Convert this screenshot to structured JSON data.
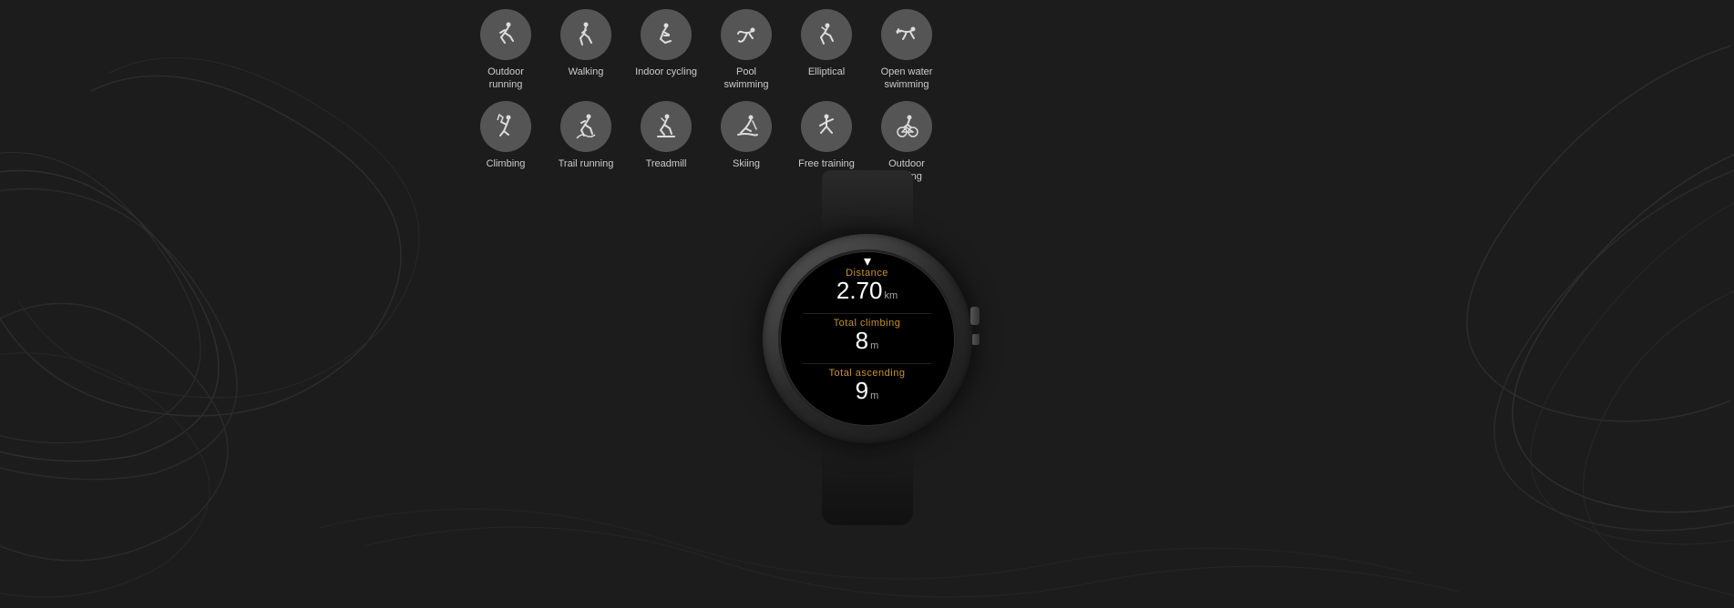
{
  "background": {
    "color": "#1a1a1a"
  },
  "activities": {
    "row1": [
      {
        "id": "outdoor-running",
        "label": "Outdoor running",
        "icon": "runner"
      },
      {
        "id": "walking",
        "label": "Walking",
        "icon": "walking"
      },
      {
        "id": "indoor-cycling",
        "label": "Indoor cycling",
        "icon": "cycling"
      },
      {
        "id": "pool-swimming",
        "label": "Pool swimming",
        "icon": "swimming"
      },
      {
        "id": "elliptical",
        "label": "Elliptical",
        "icon": "elliptical"
      },
      {
        "id": "open-water-swimming",
        "label": "Open water swimming",
        "icon": "open-water"
      }
    ],
    "row2": [
      {
        "id": "climbing",
        "label": "Climbing",
        "icon": "climbing"
      },
      {
        "id": "trail-running",
        "label": "Trail running",
        "icon": "trail-running"
      },
      {
        "id": "treadmill",
        "label": "Treadmill",
        "icon": "treadmill"
      },
      {
        "id": "skiing",
        "label": "Skiing",
        "icon": "skiing"
      },
      {
        "id": "free-training",
        "label": "Free training",
        "icon": "free-training"
      },
      {
        "id": "outdoor-cycling",
        "label": "Outdoor cycling",
        "icon": "outdoor-cycling"
      }
    ]
  },
  "watch": {
    "metrics": [
      {
        "id": "distance",
        "label": "Distance",
        "value": "2.70",
        "unit": "km"
      },
      {
        "id": "total-climbing",
        "label": "Total climbing",
        "value": "8",
        "unit": "m"
      },
      {
        "id": "total-ascending",
        "label": "Total ascending",
        "value": "9",
        "unit": "m"
      }
    ]
  }
}
